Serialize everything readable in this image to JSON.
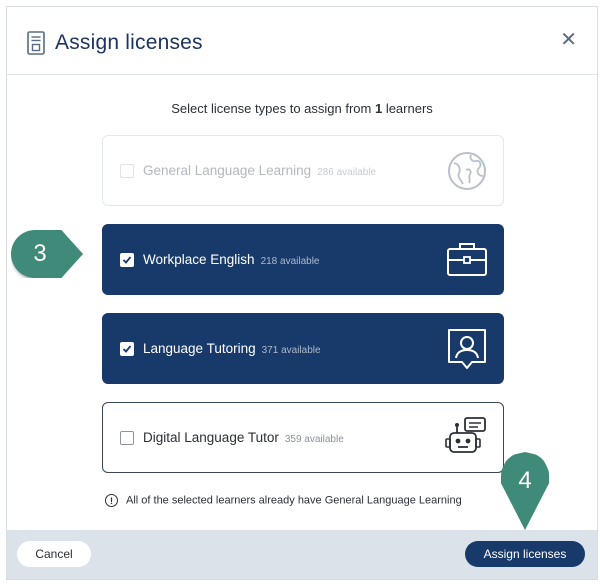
{
  "dialog": {
    "title": "Assign licenses",
    "close_icon": "close-icon",
    "title_icon": "license-document-icon",
    "subtitle_prefix": "Select license types to assign from ",
    "subtitle_count": "1",
    "subtitle_suffix": " learners"
  },
  "licenses": [
    {
      "name": "General Language Learning",
      "available": "286 available",
      "state": "disabled",
      "checked": false,
      "icon": "globe-icon"
    },
    {
      "name": "Workplace English",
      "available": "218 available",
      "state": "selected",
      "checked": true,
      "icon": "briefcase-icon"
    },
    {
      "name": "Language Tutoring",
      "available": "371 available",
      "state": "selected",
      "checked": true,
      "icon": "tutor-person-icon"
    },
    {
      "name": "Digital Language Tutor",
      "available": "359 available",
      "state": "unselected",
      "checked": false,
      "icon": "robot-icon"
    }
  ],
  "notice": {
    "icon": "!",
    "text": "All of the selected learners already have General Language Learning"
  },
  "footer": {
    "cancel_label": "Cancel",
    "assign_label": "Assign licenses"
  },
  "callouts": {
    "step_3": "3",
    "step_4": "4"
  },
  "colors": {
    "navy": "#173a6a",
    "callout_green": "#3f8a79",
    "footer_bg": "#dce2ea"
  }
}
